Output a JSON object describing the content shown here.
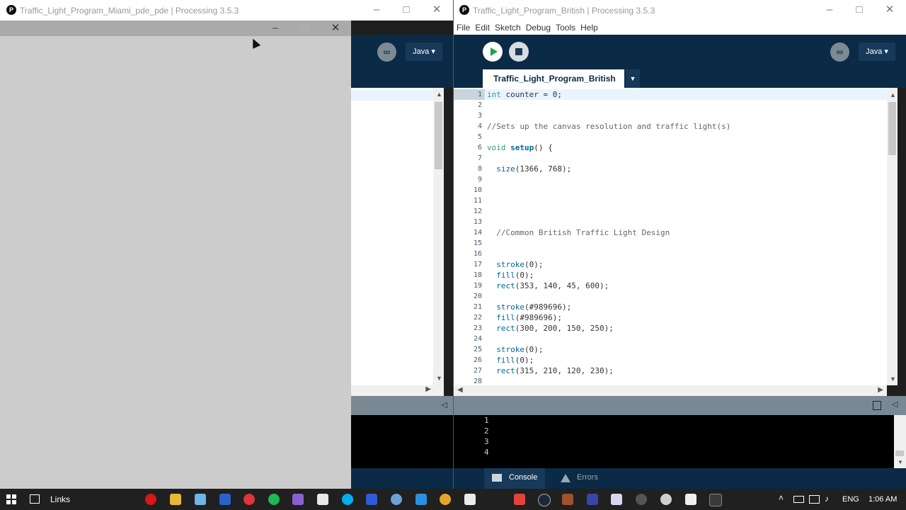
{
  "left_window": {
    "title": "Traffic_Light_Program_Miami_pde_pde | Processing 3.5.3",
    "mode_label": "Java ▾"
  },
  "right_window": {
    "title": "Traffic_Light_Program_British | Processing 3.5.3",
    "menu": [
      "File",
      "Edit",
      "Sketch",
      "Debug",
      "Tools",
      "Help"
    ],
    "mode_label": "Java ▾",
    "tab_label": "Traffic_Light_Program_British",
    "tab_arrow": "▼",
    "code_lines": [
      "int counter = 0;",
      "",
      "",
      "//Sets up the canvas resolution and traffic light(s)",
      "",
      "void setup() {",
      "",
      "  size(1366, 768);",
      "",
      "",
      "",
      "",
      "",
      "  //Common British Traffic Light Design",
      "",
      "",
      "  stroke(0);",
      "  fill(0);",
      "  rect(353, 140, 45, 600);",
      "",
      "  stroke(#989696);",
      "  fill(#989696);",
      "  rect(300, 200, 150, 250);",
      "",
      "  stroke(0);",
      "  fill(0);",
      "  rect(315, 210, 120, 230);",
      ""
    ],
    "line_numbers": [
      "1",
      "2",
      "3",
      "4",
      "5",
      "6",
      "7",
      "8",
      "9",
      "10",
      "11",
      "12",
      "13",
      "14",
      "15",
      "16",
      "17",
      "18",
      "19",
      "20",
      "21",
      "22",
      "23",
      "24",
      "25",
      "26",
      "27",
      "28"
    ],
    "console_lines": [
      "1",
      "2",
      "3",
      "4"
    ],
    "console_tab": "Console",
    "errors_tab": "Errors"
  },
  "sketch_window": {
    "background": "#cccccc"
  },
  "taskbar": {
    "links_label": "Links",
    "language": "ENG",
    "time": "1:06 AM"
  },
  "colors": {
    "processing_toolbar": "#0b2a45",
    "run_button": "#ffffff",
    "run_icon": "#1fa34a"
  }
}
